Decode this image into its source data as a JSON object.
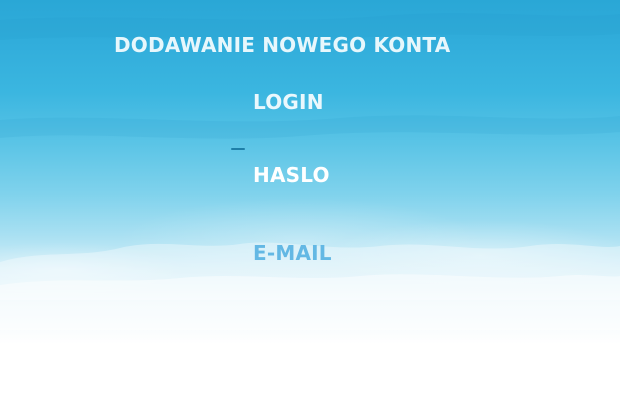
{
  "form": {
    "title": "DODAWANIE NOWEGO KONTA",
    "fields": [
      {
        "label": "LOGIN"
      },
      {
        "label": "HASLO"
      },
      {
        "label": "E-MAIL"
      }
    ]
  },
  "colors": {
    "sky_top": "#2aa7d6",
    "sky_bottom": "#ffffff",
    "email_label": "#63b8e4"
  }
}
